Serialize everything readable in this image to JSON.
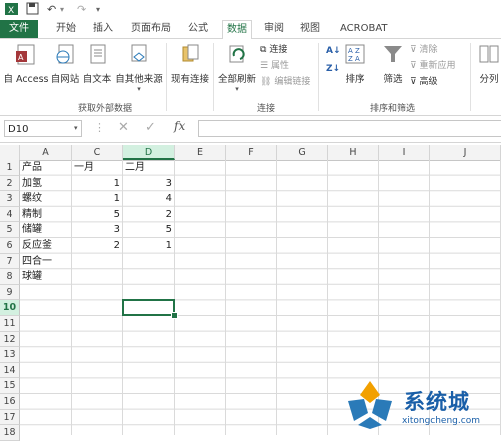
{
  "quick_access": {
    "undo": "↶",
    "redo": "↷"
  },
  "tabs": [
    "文件",
    "开始",
    "插入",
    "页面布局",
    "公式",
    "数据",
    "审阅",
    "视图",
    "ACROBAT"
  ],
  "active_tab": "数据",
  "ribbon": {
    "from_access": "自 Access",
    "from_web": "自网站",
    "from_text": "自文本",
    "from_other": "自其他来源",
    "existing": "现有连接",
    "group_external": "获取外部数据",
    "refresh_all": "全部刷新",
    "connections": "连接",
    "properties": "属性",
    "edit_links": "编辑链接",
    "group_connections": "连接",
    "sort": "排序",
    "filter": "筛选",
    "clear": "清除",
    "reapply": "重新应用",
    "advanced": "高级",
    "group_sortfilter": "排序和筛选",
    "split": "分列"
  },
  "formula_bar": {
    "name_box": "D10",
    "fx": "fx",
    "value": ""
  },
  "columns": [
    "A",
    "C",
    "D",
    "E",
    "F",
    "G",
    "H",
    "I",
    "J"
  ],
  "selected_column": "D",
  "rows": [
    "1",
    "2",
    "3",
    "4",
    "5",
    "6",
    "7",
    "8",
    "9",
    "10",
    "11",
    "12",
    "13",
    "14",
    "15",
    "16",
    "17",
    "18"
  ],
  "selected_row": "10",
  "cells": {
    "A1": "产品",
    "C1": "一月",
    "D1": "二月",
    "A2": "加氢",
    "C2": "1",
    "D2": "3",
    "A3": "螺纹",
    "C3": "1",
    "D3": "4",
    "A4": "精制",
    "C4": "5",
    "D4": "2",
    "A5": "储罐",
    "C5": "3",
    "D5": "5",
    "A6": "反应釜",
    "C6": "2",
    "D6": "1",
    "A7": "四合一",
    "A8": "球罐"
  },
  "watermark": {
    "text": "系统城",
    "url": "xitongcheng.com"
  },
  "colors": {
    "accent": "#217346",
    "watermark": "#1a5fa8"
  }
}
